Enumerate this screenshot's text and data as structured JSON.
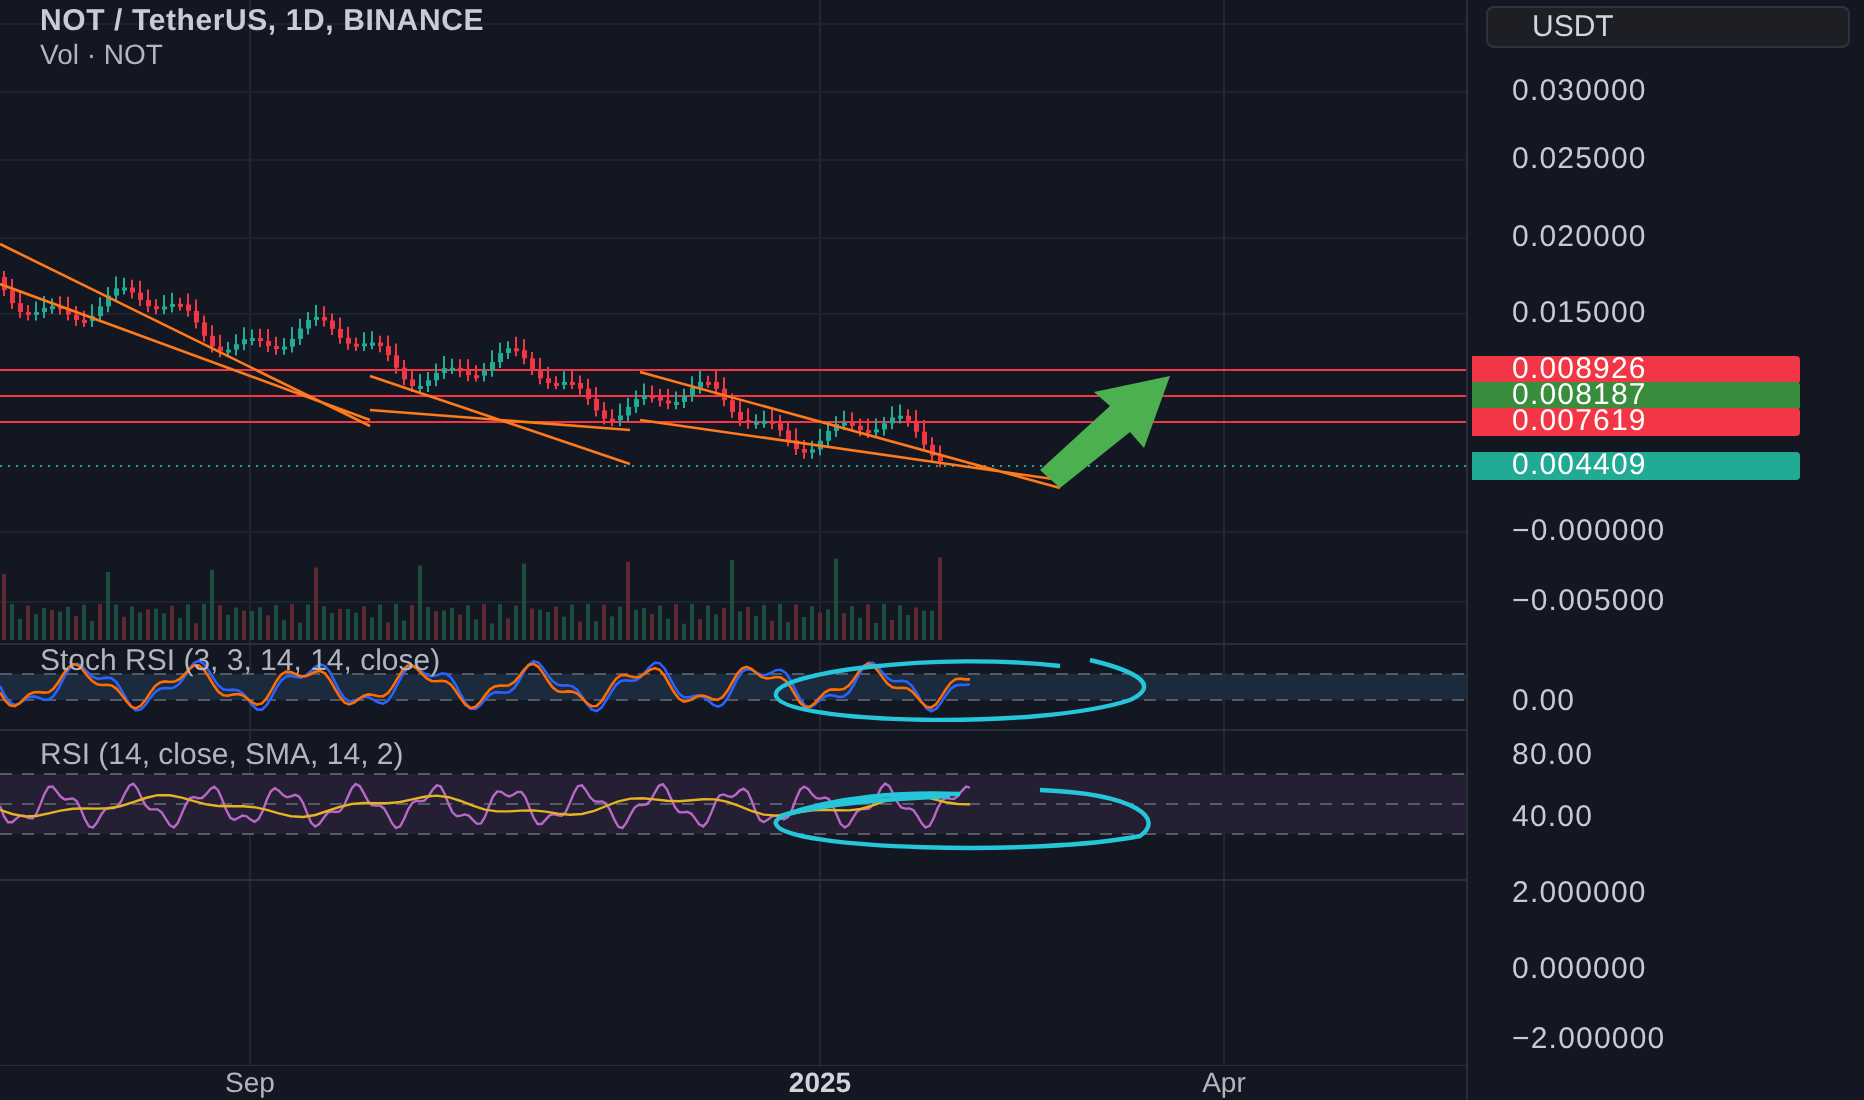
{
  "header": {
    "title": "NOT / TetherUS, 1D, BINANCE",
    "subtitle": "Vol · NOT"
  },
  "currency": "USDT",
  "price_ticks": [
    "0.030000",
    "0.025000",
    "0.020000",
    "0.015000",
    "−0.000000",
    "−0.005000"
  ],
  "price_labels": [
    {
      "value": "0.008926",
      "color": "#f23645"
    },
    {
      "value": "0.008187",
      "color": "#388e3c"
    },
    {
      "value": "0.007619",
      "color": "#f23645"
    },
    {
      "value": "0.004409",
      "color": "#22ab94"
    }
  ],
  "indicators": [
    {
      "title": "Stoch RSI (3, 3, 14, 14, close)",
      "ticks": [
        "0.00"
      ]
    },
    {
      "title": "RSI (14, close, SMA, 14, 2)",
      "ticks": [
        "80.00",
        "40.00"
      ]
    }
  ],
  "pane_3_ticks": [
    "2.000000",
    "0.000000",
    "−2.000000"
  ],
  "time_axis": [
    {
      "label": "Sep",
      "kind": "month"
    },
    {
      "label": "2025",
      "kind": "year"
    },
    {
      "label": "Apr",
      "kind": "month"
    }
  ]
}
